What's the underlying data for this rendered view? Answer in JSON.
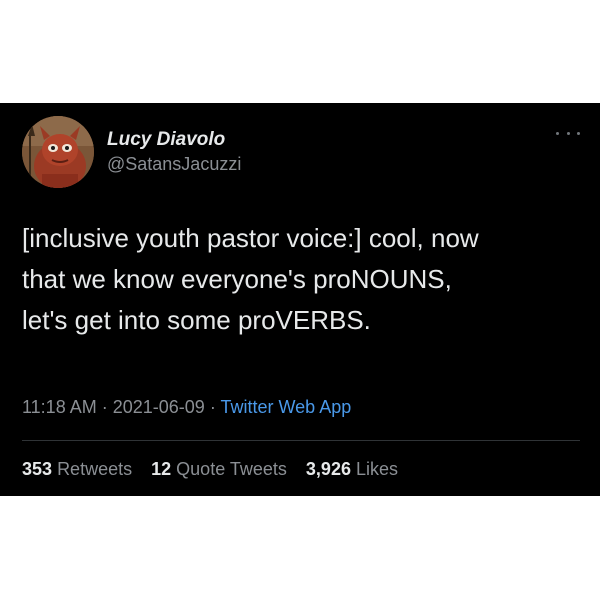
{
  "tweet": {
    "author": {
      "display_name": "Lucy Diavolo",
      "handle": "@SatansJacuzzi",
      "avatar_icon": "devil-mask-avatar-icon"
    },
    "text_lines": [
      "[inclusive youth pastor voice:] cool, now",
      "that we know everyone's proNOUNS,",
      "let's get into some proVERBS."
    ],
    "time": "11:18 AM",
    "date": "2021-06-09",
    "separator": "·",
    "source": "Twitter Web App",
    "stats": {
      "retweets_count": "353",
      "retweets_label": "Retweets",
      "quote_tweets_count": "12",
      "quote_tweets_label": "Quote Tweets",
      "likes_count": "3,926",
      "likes_label": "Likes"
    },
    "more_icon": "more-options-icon"
  },
  "colors": {
    "background": "#000000",
    "primary_text": "#e7e9ea",
    "secondary_text": "#8b8f94",
    "link": "#4a99e9",
    "divider": "#2f3336"
  }
}
